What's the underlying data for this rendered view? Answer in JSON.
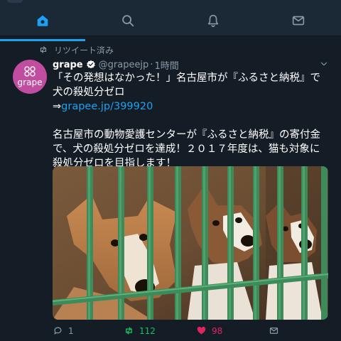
{
  "nav": {
    "tabs": [
      {
        "name": "home",
        "icon": "home-icon",
        "active": true
      },
      {
        "name": "search",
        "icon": "search-icon",
        "active": false
      },
      {
        "name": "notifications",
        "icon": "bell-icon",
        "active": false
      },
      {
        "name": "messages",
        "icon": "envelope-icon",
        "active": false
      }
    ]
  },
  "colors": {
    "background": "#141d26",
    "navbar": "#1b2836",
    "accent": "#1da1f2",
    "retweet": "#17bf63",
    "like": "#e0245e",
    "secondary_text": "#8899a6",
    "avatar": "#c04d9f"
  },
  "tweet": {
    "retweet_label": "リツイート済み",
    "author": {
      "display_name": "grape",
      "verified": true,
      "handle": "@grapeejp",
      "avatar_logo_text": "grape"
    },
    "separator": "·",
    "time": "1時間",
    "text_line1": "「その発想はなかった！」名古屋市が『ふるさと納税』で犬の殺処分ゼロ",
    "link_prefix": "⇒",
    "link": "grapee.jp/399920",
    "text_para2": "名古屋市の動物愛護センターが『ふるさと納税』の寄付金で、犬の殺処分ゼロを達成！２０１７年度は、猫も対象に殺処分ゼロを目指します！",
    "media_icon": "dogs-behind-cage-photo",
    "actions": {
      "reply_count": "1",
      "retweet_count": "112",
      "like_count": "98",
      "retweeted": true,
      "liked": true
    }
  }
}
